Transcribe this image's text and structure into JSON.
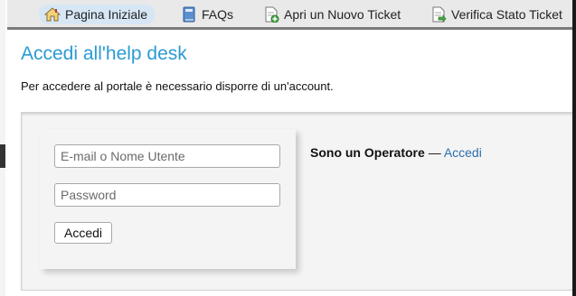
{
  "nav": {
    "items": [
      {
        "label": "Pagina Iniziale",
        "icon": "home-icon"
      },
      {
        "label": "FAQs",
        "icon": "book-icon"
      },
      {
        "label": "Apri un Nuovo Ticket",
        "icon": "new-ticket-icon"
      },
      {
        "label": "Verifica Stato Ticket",
        "icon": "check-ticket-icon"
      }
    ]
  },
  "page": {
    "title": "Accedi all'help desk",
    "intro": "Per accedere al portale è necessario disporre di un'account."
  },
  "login": {
    "username_placeholder": "E-mail o Nome Utente",
    "password_placeholder": "Password",
    "submit_label": "Accedi"
  },
  "agent": {
    "label": "Sono un Operatore",
    "separator": "—",
    "link": "Accedi"
  },
  "colors": {
    "title": "#2b9bd2",
    "link": "#2a6fb0",
    "nav_active": "#d6e6f5",
    "panel_bg": "#f4f4f4"
  }
}
